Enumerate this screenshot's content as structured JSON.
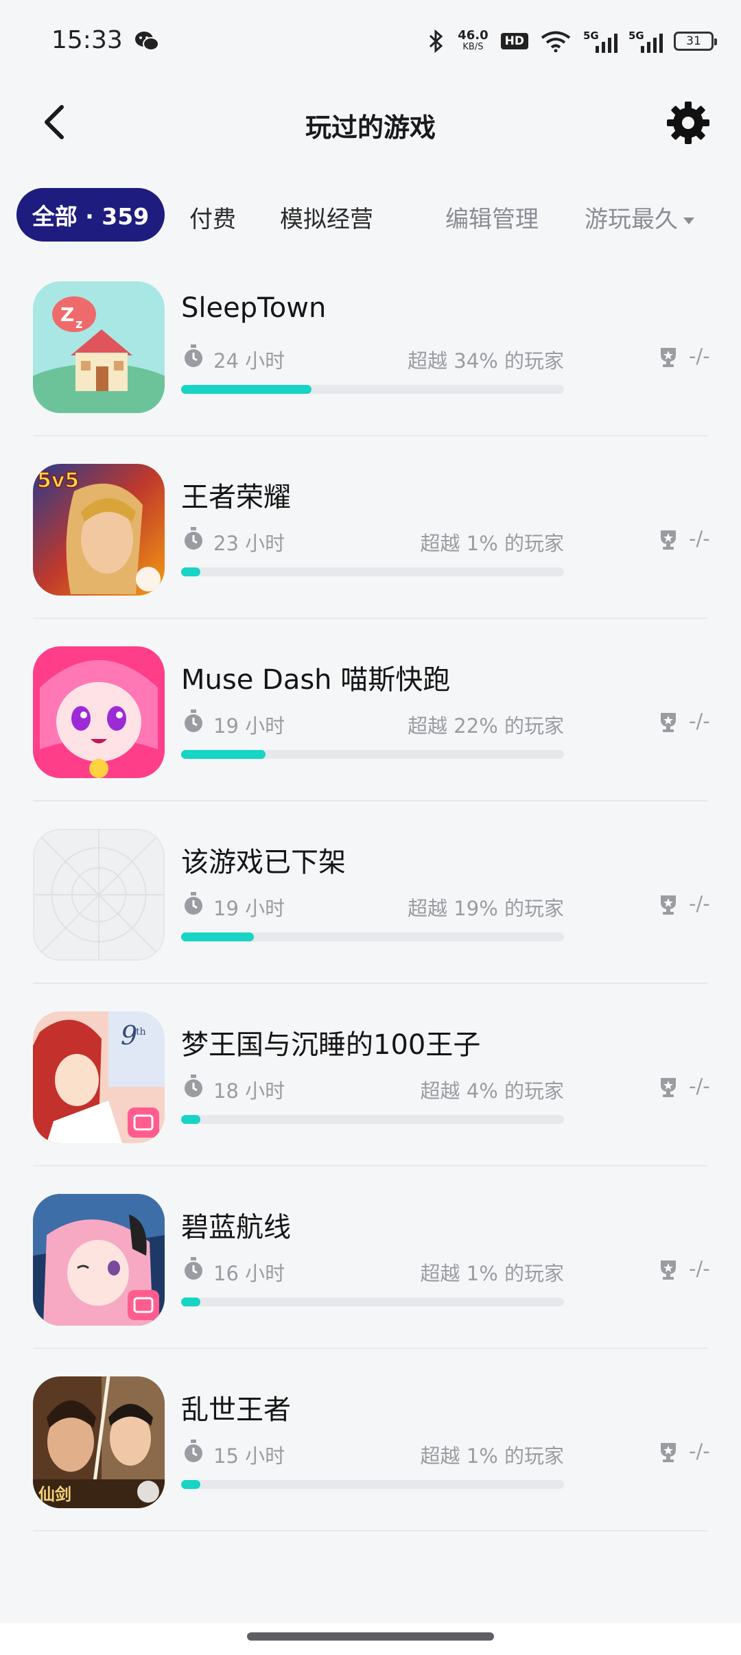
{
  "status_bar": {
    "time": "15:33",
    "net_speed": "46.0",
    "net_unit": "KB/S",
    "hd_label": "HD",
    "sim1_label": "5G",
    "sim2_label": "5G",
    "battery": "31",
    "notification_icon": "wechat-icon"
  },
  "header": {
    "title": "玩过的游戏",
    "back_icon": "back-arrow-icon",
    "settings_icon": "gear-icon"
  },
  "tabs": {
    "all_label": "全部 · 359",
    "paid_label": "付费",
    "sim_label": "模拟经营",
    "edit_label": "编辑管理",
    "sort_label": "游玩最久"
  },
  "colors": {
    "accent_tab": "#1e1c7e",
    "progress": "#17d4c5",
    "background": "#f5f6f8"
  },
  "games": [
    {
      "name": "SleepTown",
      "hours": "24 小时",
      "beats": "超越 34% 的玩家",
      "rank": "-/-",
      "progress": 0.34,
      "icon": "sleeptown-app-icon"
    },
    {
      "name": "王者荣耀",
      "hours": "23 小时",
      "beats": "超越 1% 的玩家",
      "rank": "-/-",
      "progress": 0.01,
      "icon": "honor-of-kings-app-icon"
    },
    {
      "name": "Muse Dash 喵斯快跑",
      "hours": "19 小时",
      "beats": "超越 22% 的玩家",
      "rank": "-/-",
      "progress": 0.22,
      "icon": "muse-dash-app-icon"
    },
    {
      "name": "该游戏已下架",
      "hours": "19 小时",
      "beats": "超越 19% 的玩家",
      "rank": "-/-",
      "progress": 0.19,
      "icon": "placeholder-app-icon"
    },
    {
      "name": "梦王国与沉睡的100王子",
      "hours": "18 小时",
      "beats": "超越 4% 的玩家",
      "rank": "-/-",
      "progress": 0.04,
      "icon": "dream-kingdom-app-icon"
    },
    {
      "name": "碧蓝航线",
      "hours": "16 小时",
      "beats": "超越 1% 的玩家",
      "rank": "-/-",
      "progress": 0.01,
      "icon": "azur-lane-app-icon"
    },
    {
      "name": "乱世王者",
      "hours": "15 小时",
      "beats": "超越 1% 的玩家",
      "rank": "-/-",
      "progress": 0.01,
      "icon": "luanshi-wangzhe-app-icon"
    }
  ]
}
